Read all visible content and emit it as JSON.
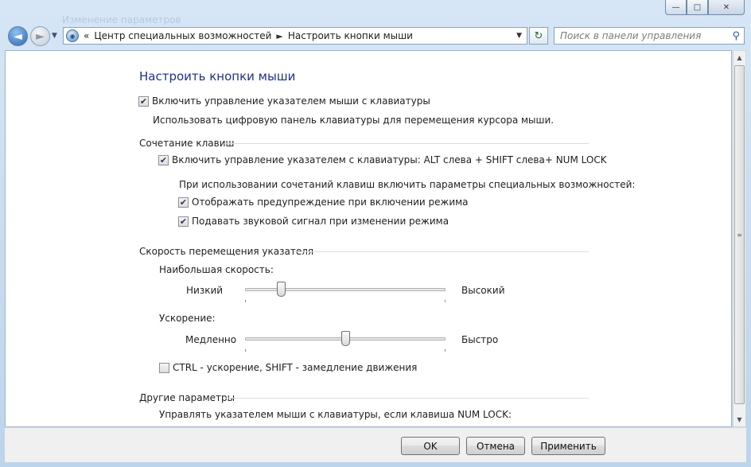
{
  "window": {
    "ghost_title": "Изменение параметров",
    "minimize": "—",
    "maximize": "□",
    "close": "✕"
  },
  "nav": {
    "back_icon": "arrow-left",
    "forward_icon": "arrow-right"
  },
  "address": {
    "overflow": "«",
    "crumbs": [
      "Центр специальных возможностей",
      "Настроить кнопки мыши"
    ],
    "separator": "►"
  },
  "search": {
    "placeholder": "Поиск в панели управления",
    "icon": "search-icon"
  },
  "page": {
    "title": "Настроить кнопки мыши",
    "enable_mousekeys": {
      "label": "Включить управление указателем мыши с клавиатуры",
      "checked": true
    },
    "enable_desc": "Использовать цифровую панель клавиатуры для перемещения курсора мыши.",
    "shortcut": {
      "heading": "Сочетание клавиш",
      "enable_shortcut": {
        "label": "Включить управление указателем с клавиатуры: ALT слева + SHIFT слева+ NUM LOCK",
        "checked": true
      },
      "subheading": "При использовании сочетаний клавиш включить параметры специальных возможностей:",
      "warn": {
        "label": "Отображать предупреждение при включении режима",
        "checked": true
      },
      "sound": {
        "label": "Подавать звуковой сигнал при изменении режима",
        "checked": true
      }
    },
    "speed": {
      "heading": "Скорость перемещения указателя",
      "top_speed_label": "Наибольшая скорость:",
      "top_low": "Низкий",
      "top_high": "Высокий",
      "top_value": 0.18,
      "accel_label": "Ускорение:",
      "accel_low": "Медленно",
      "accel_high": "Быстро",
      "accel_value": 0.5,
      "ctrl_shift": {
        "label": "CTRL - ускорение, SHIFT - замедление движения",
        "checked": false
      }
    },
    "other": {
      "heading": "Другие параметры",
      "numlock_label": "Управлять указателем мыши с клавиатуры, если клавиша NUM LOCK:"
    }
  },
  "buttons": {
    "ok": "OK",
    "cancel": "Отмена",
    "apply": "Применить"
  }
}
